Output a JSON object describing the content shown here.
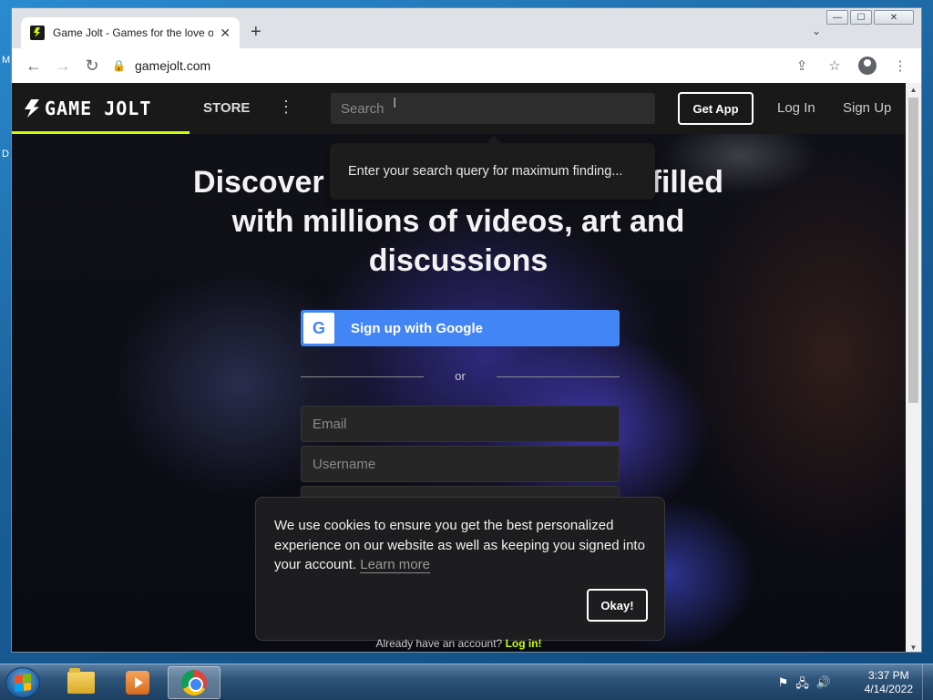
{
  "desktop": {
    "frag_top": "M",
    "frag_mid": "D"
  },
  "browser": {
    "tab": {
      "title": "Game Jolt - Games for the love of",
      "close": "✕"
    },
    "new_tab": "+",
    "tab_list": "⌄",
    "window_controls": {
      "minimize": "—",
      "maximize": "☐",
      "close": "✕"
    },
    "nav": {
      "back": "←",
      "forward": "→",
      "reload": "↻"
    },
    "lock": "🔒",
    "url": "gamejolt.com",
    "actions": {
      "share": "⇪",
      "bookmark": "☆",
      "menu": "⋮"
    },
    "scroll_up": "▲",
    "scroll_down": "▼"
  },
  "gamejolt": {
    "logo_text": "GAME JOLT",
    "store_label": "STORE",
    "more_label": "⋮",
    "search_placeholder": "Search",
    "text_cursor": "I",
    "get_app": "Get App",
    "log_in": "Log In",
    "sign_up": "Sign Up",
    "search_tooltip": "Enter your search query for maximum finding...",
    "headline_part1": "Discover",
    "headline_part2": "filled",
    "headline_line2": "with millions of videos, art and",
    "headline_line3": "discussions",
    "google_icon": "G",
    "google_button": "Sign up with Google",
    "or_text": "or",
    "email_placeholder": "Email",
    "username_placeholder": "Username",
    "cookie": {
      "text": "We use cookies to ensure you get the best personalized experience on our website as well as keeping you signed into your account.",
      "learn_more": "Learn more",
      "okay": "Okay!"
    },
    "already_text": "Already have an account?",
    "already_link": "Log in!",
    "brand_accent": "#ccff00"
  },
  "taskbar": {
    "apps": [
      "windows-explorer",
      "media-player",
      "chrome"
    ],
    "tray_icons": {
      "action_center": "⚑",
      "network": "🖧",
      "volume": "🔊"
    },
    "time": "3:37 PM",
    "date": "4/14/2022"
  }
}
